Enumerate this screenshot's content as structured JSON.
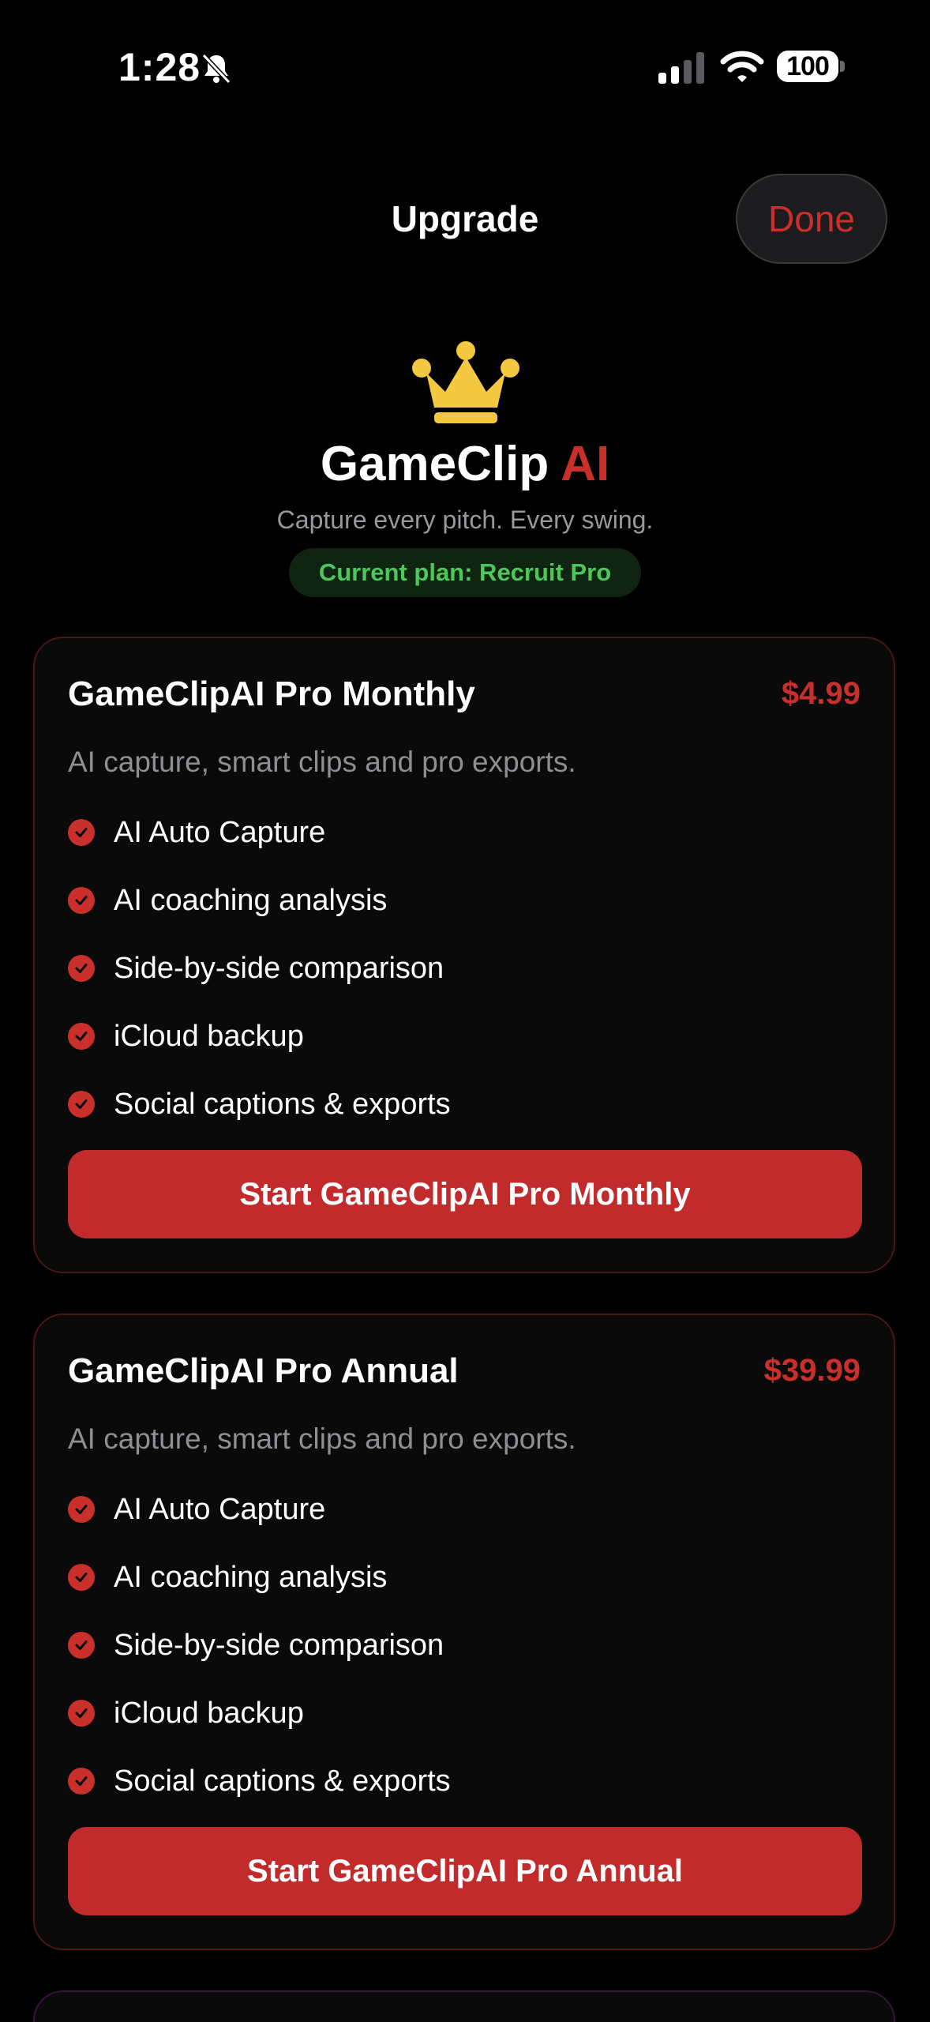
{
  "status_bar": {
    "time": "1:28",
    "battery": "100",
    "icons": [
      "bell-slash-icon",
      "cellular-signal-icon",
      "wifi-icon",
      "battery-icon"
    ]
  },
  "nav": {
    "title": "Upgrade",
    "done_label": "Done"
  },
  "hero": {
    "icon": "crown-icon",
    "app_name": "GameClip",
    "app_name_accent": "AI",
    "tagline": "Capture every pitch. Every swing.",
    "current_plan": "Current plan: Recruit Pro"
  },
  "plans": [
    {
      "name": "GameClipAI Pro Monthly",
      "price": "$4.99",
      "description": "AI capture, smart clips and pro exports.",
      "features": [
        "AI Auto Capture",
        "AI coaching analysis",
        "Side-by-side comparison",
        "iCloud backup",
        "Social captions & exports"
      ],
      "cta": "Start GameClipAI Pro Monthly"
    },
    {
      "name": "GameClipAI Pro Annual",
      "price": "$39.99",
      "description": "AI capture, smart clips and pro exports.",
      "features": [
        "AI Auto Capture",
        "AI coaching analysis",
        "Side-by-side comparison",
        "iCloud backup",
        "Social captions & exports"
      ],
      "cta": "Start GameClipAI Pro Annual"
    }
  ],
  "colors": {
    "accent": "#c9302c",
    "button": "#c12b2b",
    "badge_text": "#4cc75a",
    "muted_text": "#8e8e93",
    "crown": "#f5c842"
  }
}
